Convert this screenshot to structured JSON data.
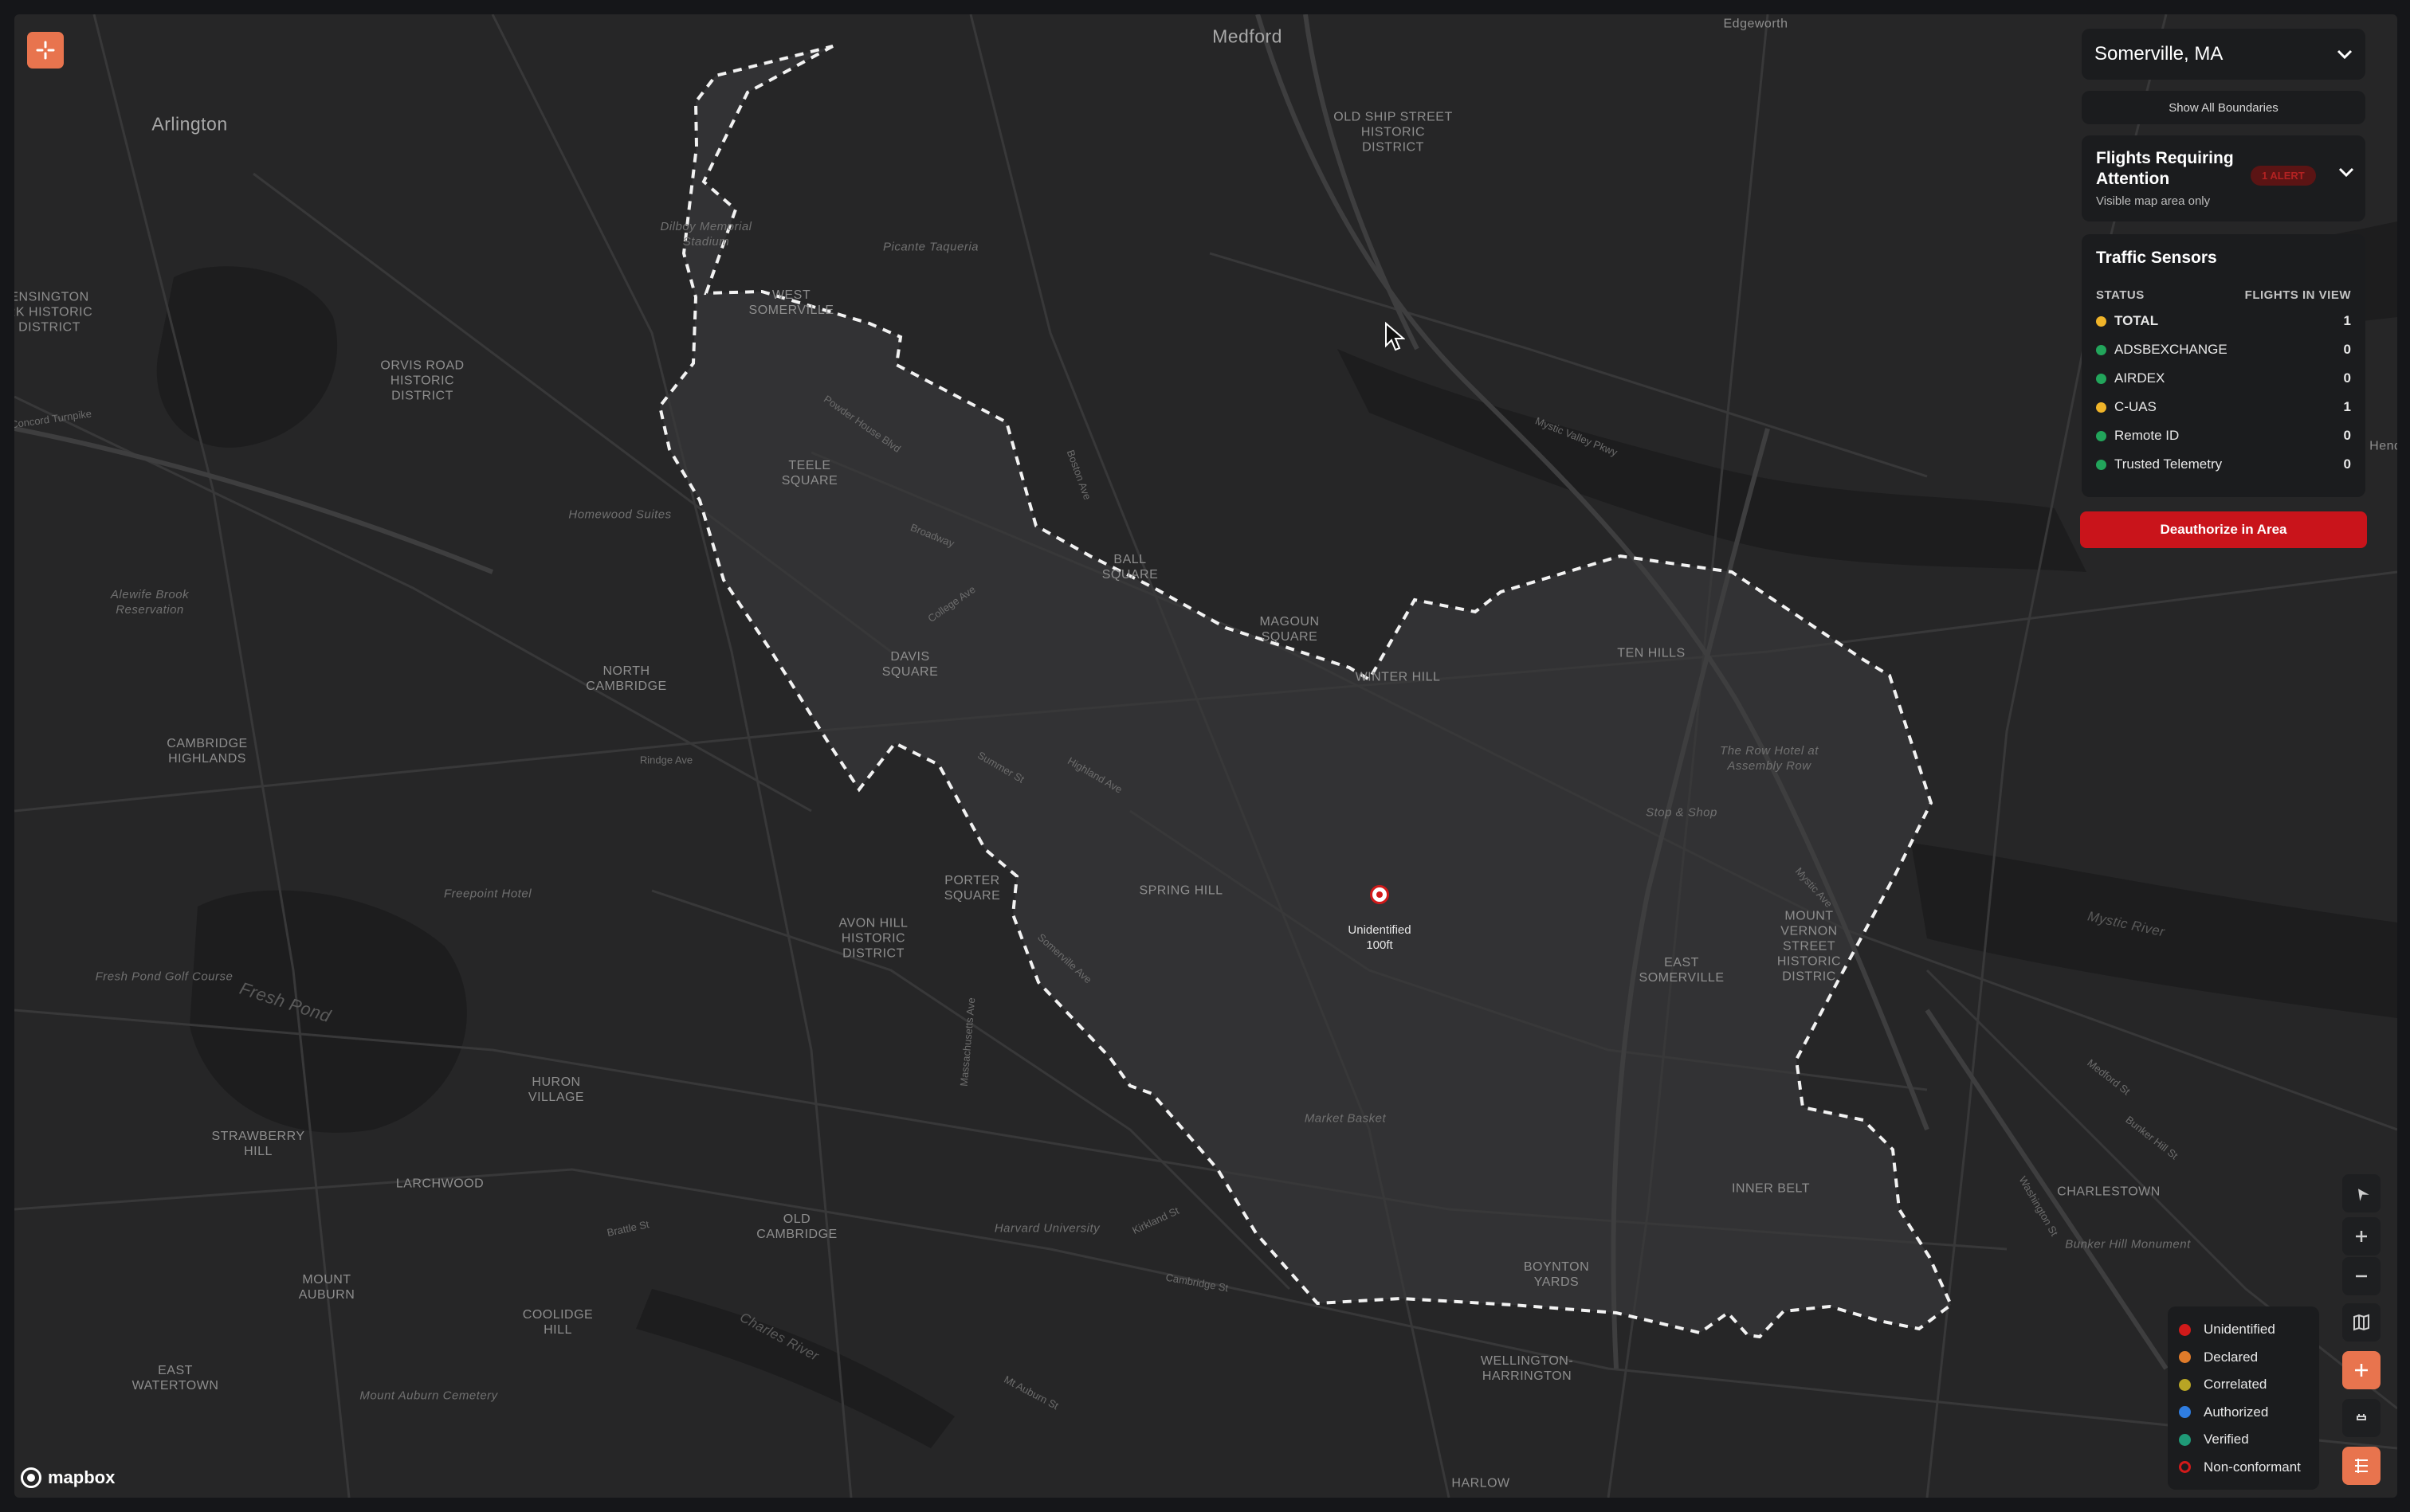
{
  "location_select": {
    "value": "Somerville, MA"
  },
  "show_boundaries_label": "Show All Boundaries",
  "flights_attention": {
    "title": "Flights Requiring Attention",
    "subtitle": "Visible map area only",
    "badge": "1 ALERT"
  },
  "traffic_sensors": {
    "title": "Traffic Sensors",
    "col_status": "STATUS",
    "col_flights": "FLIGHTS IN VIEW",
    "rows": [
      {
        "name": "TOTAL",
        "count": "1",
        "color": "#f0b429"
      },
      {
        "name": "ADSBEXCHANGE",
        "count": "0",
        "color": "#22a55b"
      },
      {
        "name": "AIRDEX",
        "count": "0",
        "color": "#22a55b"
      },
      {
        "name": "C-UAS",
        "count": "1",
        "color": "#f0b429"
      },
      {
        "name": "Remote ID",
        "count": "0",
        "color": "#22a55b"
      },
      {
        "name": "Trusted Telemetry",
        "count": "0",
        "color": "#22a55b"
      }
    ]
  },
  "deauthorize_label": "Deauthorize in Area",
  "drone": {
    "label": "Unidentified",
    "altitude": "100ft",
    "color": "#d11a1a"
  },
  "legend": [
    {
      "label": "Unidentified",
      "color": "#d11a1a",
      "ring": false
    },
    {
      "label": "Declared",
      "color": "#e07b2a",
      "ring": false
    },
    {
      "label": "Correlated",
      "color": "#b8a524",
      "ring": false
    },
    {
      "label": "Authorized",
      "color": "#2f7de1",
      "ring": false
    },
    {
      "label": "Verified",
      "color": "#1f9a77",
      "ring": false
    },
    {
      "label": "Non-conformant",
      "color": "#d11a1a",
      "ring": true
    }
  ],
  "attribution": "mapbox",
  "map_labels": {
    "medford": "Medford",
    "arlington": "Arlington",
    "edgeworth": "Edgeworth",
    "old_ship": "OLD SHIP STREET\nHISTORIC\nDISTRICT",
    "west_somerville": "WEST\nSOMERVILLE",
    "orvis": "ORVIS ROAD\nHISTORIC\nDISTRICT",
    "ensington": "ENSINGTON\nRK HISTORIC\nDISTRICT",
    "teele": "TEELE\nSQUARE",
    "ball": "BALL\nSQUARE",
    "magoun": "MAGOUN\nSQUARE",
    "winter_hill": "WINTER HILL",
    "ten_hills": "TEN HILLS",
    "north_cambridge": "NORTH\nCAMBRIDGE",
    "davis": "DAVIS\nSQUARE",
    "cambridge_highlands": "CAMBRIDGE\nHIGHLANDS",
    "spring_hill": "SPRING HILL",
    "porter": "PORTER\nSQUARE",
    "avon_hill": "AVON HILL\nHISTORIC\nDISTRICT",
    "east_somerville": "EAST\nSOMERVILLE",
    "mount_vernon": "MOUNT\nVERNON\nSTREET\nHISTORIC\nDISTRIC",
    "huron": "HURON\nVILLAGE",
    "strawberry": "STRAWBERRY\nHILL",
    "larchwood": "LARCHWOOD",
    "old_cambridge": "OLD\nCAMBRIDGE",
    "inner_belt": "INNER BELT",
    "boynton": "BOYNTON\nYARDS",
    "charlestown": "CHARLESTOWN",
    "mount_auburn": "MOUNT\nAUBURN",
    "coolidge": "COOLIDGE\nHILL",
    "east_watertown": "EAST\nWATERTOWN",
    "wellington": "WELLINGTON-\nHARRINGTON",
    "harlow": "HARLOW",
    "fresh_pond": "Fresh Pond",
    "mystic_river": "Mystic River",
    "charles_river": "Charles River",
    "alewife": "Alewife Brook\nReservation",
    "fresh_pond_golf": "Fresh Pond Golf Course",
    "freepoint": "Freepoint Hotel",
    "harvard": "Harvard University",
    "mount_auburn_cem": "Mount Auburn Cemetery",
    "market_basket": "Market Basket",
    "stop_shop": "Stop & Shop",
    "row_hotel": "The Row Hotel at\nAssembly Row",
    "bunker_hill": "Bunker Hill Monument",
    "homewood": "Homewood Suites",
    "picante": "Picante Taqueria",
    "dilboy": "Dilboy Memorial\nStadium",
    "broadway": "Broadway",
    "highland": "Highland Ave",
    "summer": "Summer St",
    "somerville_ave": "Somerville Ave",
    "cambridge_st": "Cambridge St",
    "mass_ave": "Massachusetts Ave",
    "mystic_valley": "Mystic Valley Pkwy",
    "powder_house": "Powder House Blvd",
    "college_ave": "College Ave",
    "boston_ave": "Boston Ave",
    "kirkland": "Kirkland St",
    "brattle": "Brattle St",
    "mt_auburn_st": "Mt Auburn St",
    "rindge": "Rindge Ave",
    "concord": "Concord Turnpike",
    "mystic_ave": "Mystic Ave",
    "medford_st": "Medford St",
    "bunker_hill_st": "Bunker Hill St",
    "washington": "Washington St",
    "hende": "Hende"
  }
}
